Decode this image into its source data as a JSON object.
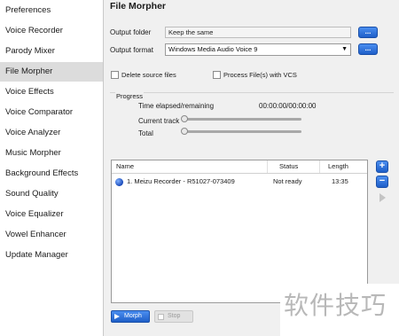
{
  "sidebar": {
    "items": [
      {
        "label": "Preferences"
      },
      {
        "label": "Voice Recorder"
      },
      {
        "label": "Parody Mixer"
      },
      {
        "label": "File Morpher"
      },
      {
        "label": "Voice Effects"
      },
      {
        "label": "Voice Comparator"
      },
      {
        "label": "Voice Analyzer"
      },
      {
        "label": "Music Morpher"
      },
      {
        "label": "Background Effects"
      },
      {
        "label": "Sound Quality"
      },
      {
        "label": "Voice Equalizer"
      },
      {
        "label": "Vowel Enhancer"
      },
      {
        "label": "Update Manager"
      }
    ],
    "active_index": 3
  },
  "main": {
    "title": "File Morpher",
    "output_folder": {
      "label": "Output folder",
      "value": "Keep the same",
      "browse_label": "..."
    },
    "output_format": {
      "label": "Output format",
      "value": "Windows Media Audio Voice 9",
      "browse_label": "..."
    },
    "delete_source": {
      "label": "Delete source files",
      "checked": false
    },
    "process_vcs": {
      "label": "Process File(s) with VCS",
      "checked": false
    },
    "progress": {
      "legend": "Progress",
      "time_label": "Time elapsed/remaining",
      "time_value": "00:00:00/00:00:00",
      "current_track_label": "Current track",
      "current_track_fraction": 0,
      "total_label": "Total",
      "total_fraction": 0
    },
    "file_list": {
      "columns": [
        "Name",
        "Status",
        "Length"
      ],
      "rows": [
        {
          "name": "1. Meizu  Recorder - R51027-073409",
          "status": "Not ready",
          "length": "13:35"
        }
      ]
    },
    "buttons": {
      "add": "+",
      "remove": "−",
      "morph": "Morph",
      "stop": "Stop"
    }
  },
  "watermark": "软件技巧",
  "colors": {
    "accent": "#2a6ee0",
    "active_item": "#dcdcdc",
    "sidebar_bg": "#ffffff",
    "panel_bg": "#f0f0f0"
  }
}
